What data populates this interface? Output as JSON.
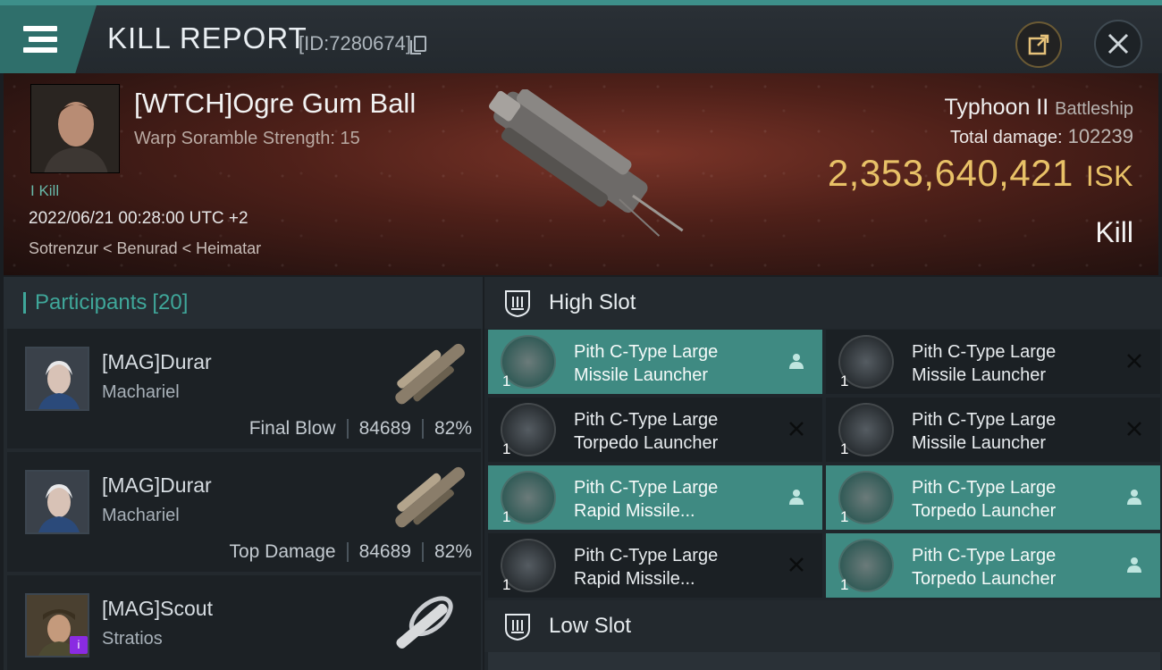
{
  "header": {
    "title": "KILL REPORT",
    "report_id": "[ID:7280674]",
    "icons": {
      "menu": "hamburger-menu-icon",
      "share": "share-export-icon",
      "close": "close-icon",
      "copy": "copy-icon"
    },
    "accent": "#3d8f8a"
  },
  "victim": {
    "name": "[WTCH]Ogre Gum Ball",
    "subtitle": "Warp Soramble Strength: 15",
    "kill_tag": "I Kill",
    "datetime": "2022/06/21 00:28:00 UTC +2",
    "location": "Sotrenzur < Benurad < Heimatar",
    "ship_name": "Typhoon II",
    "ship_class": "Battleship",
    "total_damage_label": "Total damage:",
    "total_damage": "102239",
    "isk_value": "2,353,640,421",
    "isk_unit": "ISK",
    "result": "Kill"
  },
  "participants": {
    "label": "Participants",
    "count": "[20]",
    "items": [
      {
        "name": "[MAG]Durar",
        "ship": "Machariel",
        "role": "Final Blow",
        "damage": "84689",
        "percent": "82%"
      },
      {
        "name": "[MAG]Durar",
        "ship": "Machariel",
        "role": "Top Damage",
        "damage": "84689",
        "percent": "82%"
      },
      {
        "name": "[MAG]Scout",
        "ship": "Stratios",
        "role": "",
        "damage": "",
        "percent": ""
      }
    ]
  },
  "fitting": {
    "high_slot_label": "High Slot",
    "low_slot_label": "Low Slot",
    "modules": [
      {
        "line1": "Pith C-Type Large",
        "line2": "Missile Launcher",
        "qty": "1",
        "state": "dropped"
      },
      {
        "line1": "Pith C-Type Large",
        "line2": "Missile Launcher",
        "qty": "1",
        "state": "destroyed"
      },
      {
        "line1": "Pith C-Type Large",
        "line2": "Torpedo Launcher",
        "qty": "1",
        "state": "destroyed"
      },
      {
        "line1": "Pith C-Type Large",
        "line2": "Missile Launcher",
        "qty": "1",
        "state": "destroyed"
      },
      {
        "line1": "Pith C-Type Large",
        "line2": "Rapid Missile...",
        "qty": "1",
        "state": "dropped"
      },
      {
        "line1": "Pith C-Type Large",
        "line2": "Torpedo Launcher",
        "qty": "1",
        "state": "dropped"
      },
      {
        "line1": "Pith C-Type Large",
        "line2": "Rapid Missile...",
        "qty": "1",
        "state": "destroyed"
      },
      {
        "line1": "Pith C-Type Large",
        "line2": "Torpedo Launcher",
        "qty": "1",
        "state": "dropped"
      }
    ],
    "colors": {
      "dropped": "#3f8a82",
      "destroyed": "#1b2024",
      "isk": "#e8c167"
    }
  }
}
